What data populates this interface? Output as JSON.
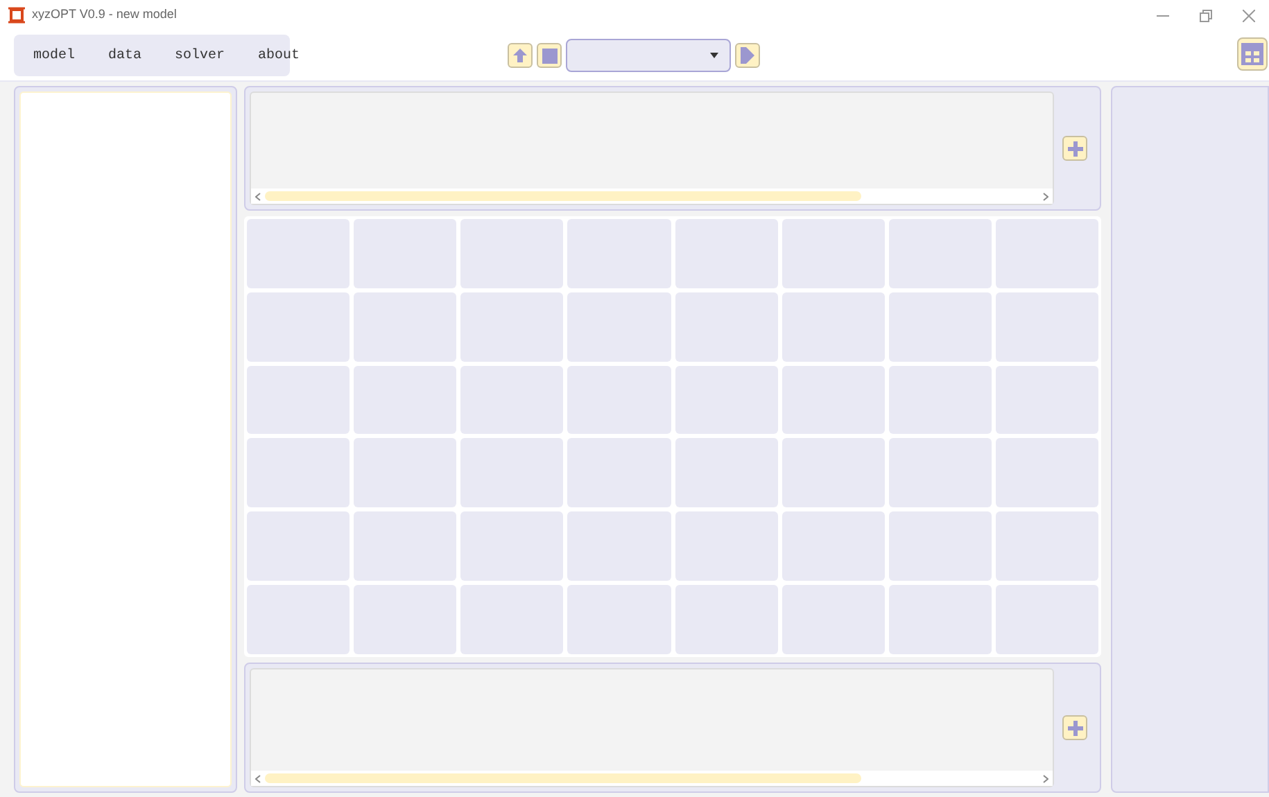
{
  "window": {
    "title": "xyzOPT V0.9 - new model"
  },
  "menu": [
    {
      "label": "model"
    },
    {
      "label": "data"
    },
    {
      "label": "solver"
    },
    {
      "label": "about"
    }
  ]
}
